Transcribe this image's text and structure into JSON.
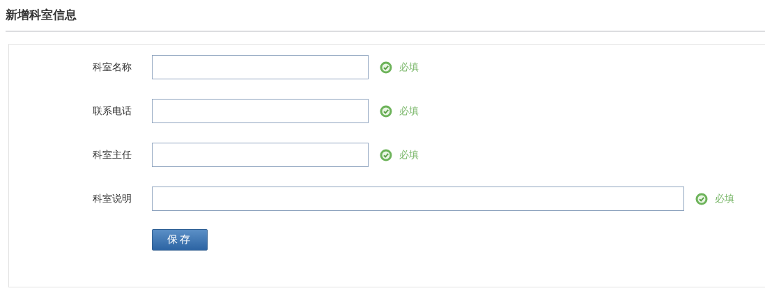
{
  "title": "新增科室信息",
  "fields": [
    {
      "label": "科室名称",
      "kind": "short",
      "hint": "必填"
    },
    {
      "label": "联系电话",
      "kind": "short",
      "hint": "必填"
    },
    {
      "label": "科室主任",
      "kind": "short",
      "hint": "必填"
    },
    {
      "label": "科室说明",
      "kind": "wide",
      "hint": "必填"
    }
  ],
  "save_button": "保存"
}
